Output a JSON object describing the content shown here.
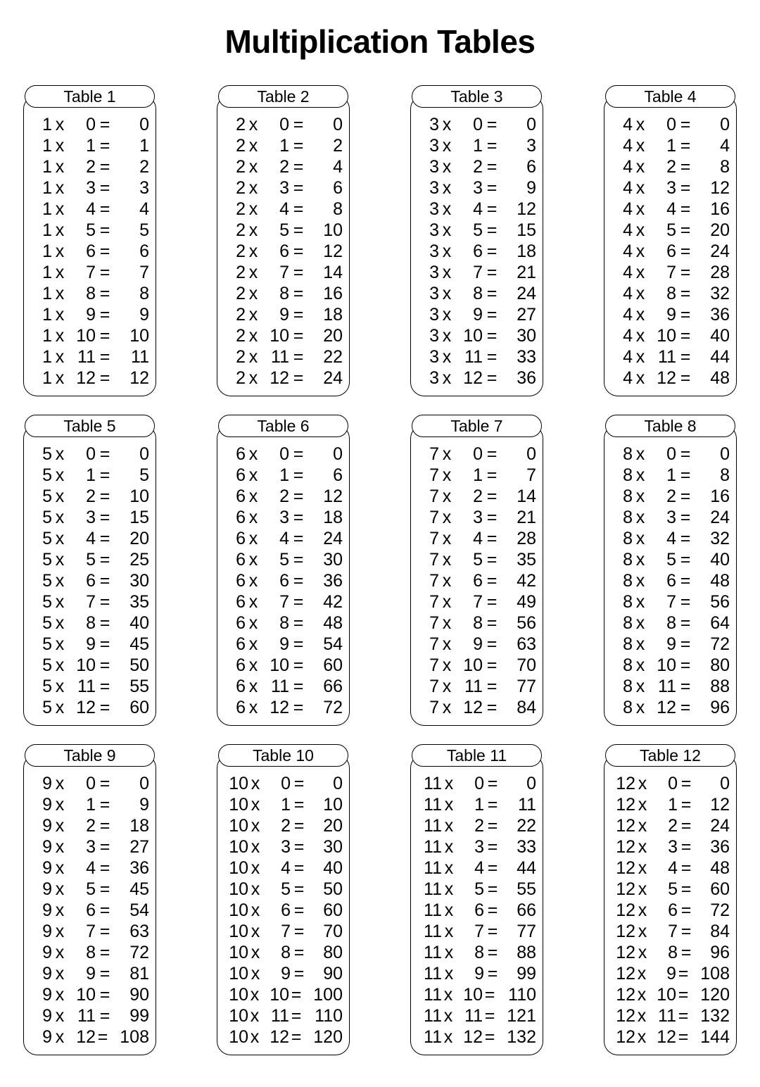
{
  "document": {
    "title": "Multiplication Tables"
  },
  "operators": {
    "times": "x",
    "equals": "="
  },
  "tables": [
    {
      "header": "Table 1",
      "base": "1",
      "rows": [
        {
          "a": "1",
          "b": "0",
          "r": "0"
        },
        {
          "a": "1",
          "b": "1",
          "r": "1"
        },
        {
          "a": "1",
          "b": "2",
          "r": "2"
        },
        {
          "a": "1",
          "b": "3",
          "r": "3"
        },
        {
          "a": "1",
          "b": "4",
          "r": "4"
        },
        {
          "a": "1",
          "b": "5",
          "r": "5"
        },
        {
          "a": "1",
          "b": "6",
          "r": "6"
        },
        {
          "a": "1",
          "b": "7",
          "r": "7"
        },
        {
          "a": "1",
          "b": "8",
          "r": "8"
        },
        {
          "a": "1",
          "b": "9",
          "r": "9"
        },
        {
          "a": "1",
          "b": "10",
          "r": "10"
        },
        {
          "a": "1",
          "b": "11",
          "r": "11"
        },
        {
          "a": "1",
          "b": "12",
          "r": "12"
        }
      ]
    },
    {
      "header": "Table 2",
      "base": "2",
      "rows": [
        {
          "a": "2",
          "b": "0",
          "r": "0"
        },
        {
          "a": "2",
          "b": "1",
          "r": "2"
        },
        {
          "a": "2",
          "b": "2",
          "r": "4"
        },
        {
          "a": "2",
          "b": "3",
          "r": "6"
        },
        {
          "a": "2",
          "b": "4",
          "r": "8"
        },
        {
          "a": "2",
          "b": "5",
          "r": "10"
        },
        {
          "a": "2",
          "b": "6",
          "r": "12"
        },
        {
          "a": "2",
          "b": "7",
          "r": "14"
        },
        {
          "a": "2",
          "b": "8",
          "r": "16"
        },
        {
          "a": "2",
          "b": "9",
          "r": "18"
        },
        {
          "a": "2",
          "b": "10",
          "r": "20"
        },
        {
          "a": "2",
          "b": "11",
          "r": "22"
        },
        {
          "a": "2",
          "b": "12",
          "r": "24"
        }
      ]
    },
    {
      "header": "Table 3",
      "base": "3",
      "rows": [
        {
          "a": "3",
          "b": "0",
          "r": "0"
        },
        {
          "a": "3",
          "b": "1",
          "r": "3"
        },
        {
          "a": "3",
          "b": "2",
          "r": "6"
        },
        {
          "a": "3",
          "b": "3",
          "r": "9"
        },
        {
          "a": "3",
          "b": "4",
          "r": "12"
        },
        {
          "a": "3",
          "b": "5",
          "r": "15"
        },
        {
          "a": "3",
          "b": "6",
          "r": "18"
        },
        {
          "a": "3",
          "b": "7",
          "r": "21"
        },
        {
          "a": "3",
          "b": "8",
          "r": "24"
        },
        {
          "a": "3",
          "b": "9",
          "r": "27"
        },
        {
          "a": "3",
          "b": "10",
          "r": "30"
        },
        {
          "a": "3",
          "b": "11",
          "r": "33"
        },
        {
          "a": "3",
          "b": "12",
          "r": "36"
        }
      ]
    },
    {
      "header": "Table 4",
      "base": "4",
      "rows": [
        {
          "a": "4",
          "b": "0",
          "r": "0"
        },
        {
          "a": "4",
          "b": "1",
          "r": "4"
        },
        {
          "a": "4",
          "b": "2",
          "r": "8"
        },
        {
          "a": "4",
          "b": "3",
          "r": "12"
        },
        {
          "a": "4",
          "b": "4",
          "r": "16"
        },
        {
          "a": "4",
          "b": "5",
          "r": "20"
        },
        {
          "a": "4",
          "b": "6",
          "r": "24"
        },
        {
          "a": "4",
          "b": "7",
          "r": "28"
        },
        {
          "a": "4",
          "b": "8",
          "r": "32"
        },
        {
          "a": "4",
          "b": "9",
          "r": "36"
        },
        {
          "a": "4",
          "b": "10",
          "r": "40"
        },
        {
          "a": "4",
          "b": "11",
          "r": "44"
        },
        {
          "a": "4",
          "b": "12",
          "r": "48"
        }
      ]
    },
    {
      "header": "Table 5",
      "base": "5",
      "rows": [
        {
          "a": "5",
          "b": "0",
          "r": "0"
        },
        {
          "a": "5",
          "b": "1",
          "r": "5"
        },
        {
          "a": "5",
          "b": "2",
          "r": "10"
        },
        {
          "a": "5",
          "b": "3",
          "r": "15"
        },
        {
          "a": "5",
          "b": "4",
          "r": "20"
        },
        {
          "a": "5",
          "b": "5",
          "r": "25"
        },
        {
          "a": "5",
          "b": "6",
          "r": "30"
        },
        {
          "a": "5",
          "b": "7",
          "r": "35"
        },
        {
          "a": "5",
          "b": "8",
          "r": "40"
        },
        {
          "a": "5",
          "b": "9",
          "r": "45"
        },
        {
          "a": "5",
          "b": "10",
          "r": "50"
        },
        {
          "a": "5",
          "b": "11",
          "r": "55"
        },
        {
          "a": "5",
          "b": "12",
          "r": "60"
        }
      ]
    },
    {
      "header": "Table 6",
      "base": "6",
      "rows": [
        {
          "a": "6",
          "b": "0",
          "r": "0"
        },
        {
          "a": "6",
          "b": "1",
          "r": "6"
        },
        {
          "a": "6",
          "b": "2",
          "r": "12"
        },
        {
          "a": "6",
          "b": "3",
          "r": "18"
        },
        {
          "a": "6",
          "b": "4",
          "r": "24"
        },
        {
          "a": "6",
          "b": "5",
          "r": "30"
        },
        {
          "a": "6",
          "b": "6",
          "r": "36"
        },
        {
          "a": "6",
          "b": "7",
          "r": "42"
        },
        {
          "a": "6",
          "b": "8",
          "r": "48"
        },
        {
          "a": "6",
          "b": "9",
          "r": "54"
        },
        {
          "a": "6",
          "b": "10",
          "r": "60"
        },
        {
          "a": "6",
          "b": "11",
          "r": "66"
        },
        {
          "a": "6",
          "b": "12",
          "r": "72"
        }
      ]
    },
    {
      "header": "Table 7",
      "base": "7",
      "rows": [
        {
          "a": "7",
          "b": "0",
          "r": "0"
        },
        {
          "a": "7",
          "b": "1",
          "r": "7"
        },
        {
          "a": "7",
          "b": "2",
          "r": "14"
        },
        {
          "a": "7",
          "b": "3",
          "r": "21"
        },
        {
          "a": "7",
          "b": "4",
          "r": "28"
        },
        {
          "a": "7",
          "b": "5",
          "r": "35"
        },
        {
          "a": "7",
          "b": "6",
          "r": "42"
        },
        {
          "a": "7",
          "b": "7",
          "r": "49"
        },
        {
          "a": "7",
          "b": "8",
          "r": "56"
        },
        {
          "a": "7",
          "b": "9",
          "r": "63"
        },
        {
          "a": "7",
          "b": "10",
          "r": "70"
        },
        {
          "a": "7",
          "b": "11",
          "r": "77"
        },
        {
          "a": "7",
          "b": "12",
          "r": "84"
        }
      ]
    },
    {
      "header": "Table 8",
      "base": "8",
      "rows": [
        {
          "a": "8",
          "b": "0",
          "r": "0"
        },
        {
          "a": "8",
          "b": "1",
          "r": "8"
        },
        {
          "a": "8",
          "b": "2",
          "r": "16"
        },
        {
          "a": "8",
          "b": "3",
          "r": "24"
        },
        {
          "a": "8",
          "b": "4",
          "r": "32"
        },
        {
          "a": "8",
          "b": "5",
          "r": "40"
        },
        {
          "a": "8",
          "b": "6",
          "r": "48"
        },
        {
          "a": "8",
          "b": "7",
          "r": "56"
        },
        {
          "a": "8",
          "b": "8",
          "r": "64"
        },
        {
          "a": "8",
          "b": "9",
          "r": "72"
        },
        {
          "a": "8",
          "b": "10",
          "r": "80"
        },
        {
          "a": "8",
          "b": "11",
          "r": "88"
        },
        {
          "a": "8",
          "b": "12",
          "r": "96"
        }
      ]
    },
    {
      "header": "Table 9",
      "base": "9",
      "rows": [
        {
          "a": "9",
          "b": "0",
          "r": "0"
        },
        {
          "a": "9",
          "b": "1",
          "r": "9"
        },
        {
          "a": "9",
          "b": "2",
          "r": "18"
        },
        {
          "a": "9",
          "b": "3",
          "r": "27"
        },
        {
          "a": "9",
          "b": "4",
          "r": "36"
        },
        {
          "a": "9",
          "b": "5",
          "r": "45"
        },
        {
          "a": "9",
          "b": "6",
          "r": "54"
        },
        {
          "a": "9",
          "b": "7",
          "r": "63"
        },
        {
          "a": "9",
          "b": "8",
          "r": "72"
        },
        {
          "a": "9",
          "b": "9",
          "r": "81"
        },
        {
          "a": "9",
          "b": "10",
          "r": "90"
        },
        {
          "a": "9",
          "b": "11",
          "r": "99"
        },
        {
          "a": "9",
          "b": "12",
          "r": "108"
        }
      ]
    },
    {
      "header": "Table 10",
      "base": "10",
      "rows": [
        {
          "a": "10",
          "b": "0",
          "r": "0"
        },
        {
          "a": "10",
          "b": "1",
          "r": "10"
        },
        {
          "a": "10",
          "b": "2",
          "r": "20"
        },
        {
          "a": "10",
          "b": "3",
          "r": "30"
        },
        {
          "a": "10",
          "b": "4",
          "r": "40"
        },
        {
          "a": "10",
          "b": "5",
          "r": "50"
        },
        {
          "a": "10",
          "b": "6",
          "r": "60"
        },
        {
          "a": "10",
          "b": "7",
          "r": "70"
        },
        {
          "a": "10",
          "b": "8",
          "r": "80"
        },
        {
          "a": "10",
          "b": "9",
          "r": "90"
        },
        {
          "a": "10",
          "b": "10",
          "r": "100"
        },
        {
          "a": "10",
          "b": "11",
          "r": "110"
        },
        {
          "a": "10",
          "b": "12",
          "r": "120"
        }
      ]
    },
    {
      "header": "Table 11",
      "base": "11",
      "rows": [
        {
          "a": "11",
          "b": "0",
          "r": "0"
        },
        {
          "a": "11",
          "b": "1",
          "r": "11"
        },
        {
          "a": "11",
          "b": "2",
          "r": "22"
        },
        {
          "a": "11",
          "b": "3",
          "r": "33"
        },
        {
          "a": "11",
          "b": "4",
          "r": "44"
        },
        {
          "a": "11",
          "b": "5",
          "r": "55"
        },
        {
          "a": "11",
          "b": "6",
          "r": "66"
        },
        {
          "a": "11",
          "b": "7",
          "r": "77"
        },
        {
          "a": "11",
          "b": "8",
          "r": "88"
        },
        {
          "a": "11",
          "b": "9",
          "r": "99"
        },
        {
          "a": "11",
          "b": "10",
          "r": "110"
        },
        {
          "a": "11",
          "b": "11",
          "r": "121"
        },
        {
          "a": "11",
          "b": "12",
          "r": "132"
        }
      ]
    },
    {
      "header": "Table 12",
      "base": "12",
      "rows": [
        {
          "a": "12",
          "b": "0",
          "r": "0"
        },
        {
          "a": "12",
          "b": "1",
          "r": "12"
        },
        {
          "a": "12",
          "b": "2",
          "r": "24"
        },
        {
          "a": "12",
          "b": "3",
          "r": "36"
        },
        {
          "a": "12",
          "b": "4",
          "r": "48"
        },
        {
          "a": "12",
          "b": "5",
          "r": "60"
        },
        {
          "a": "12",
          "b": "6",
          "r": "72"
        },
        {
          "a": "12",
          "b": "7",
          "r": "84"
        },
        {
          "a": "12",
          "b": "8",
          "r": "96"
        },
        {
          "a": "12",
          "b": "9",
          "r": "108"
        },
        {
          "a": "12",
          "b": "10",
          "r": "120"
        },
        {
          "a": "12",
          "b": "11",
          "r": "132"
        },
        {
          "a": "12",
          "b": "12",
          "r": "144"
        }
      ]
    }
  ]
}
